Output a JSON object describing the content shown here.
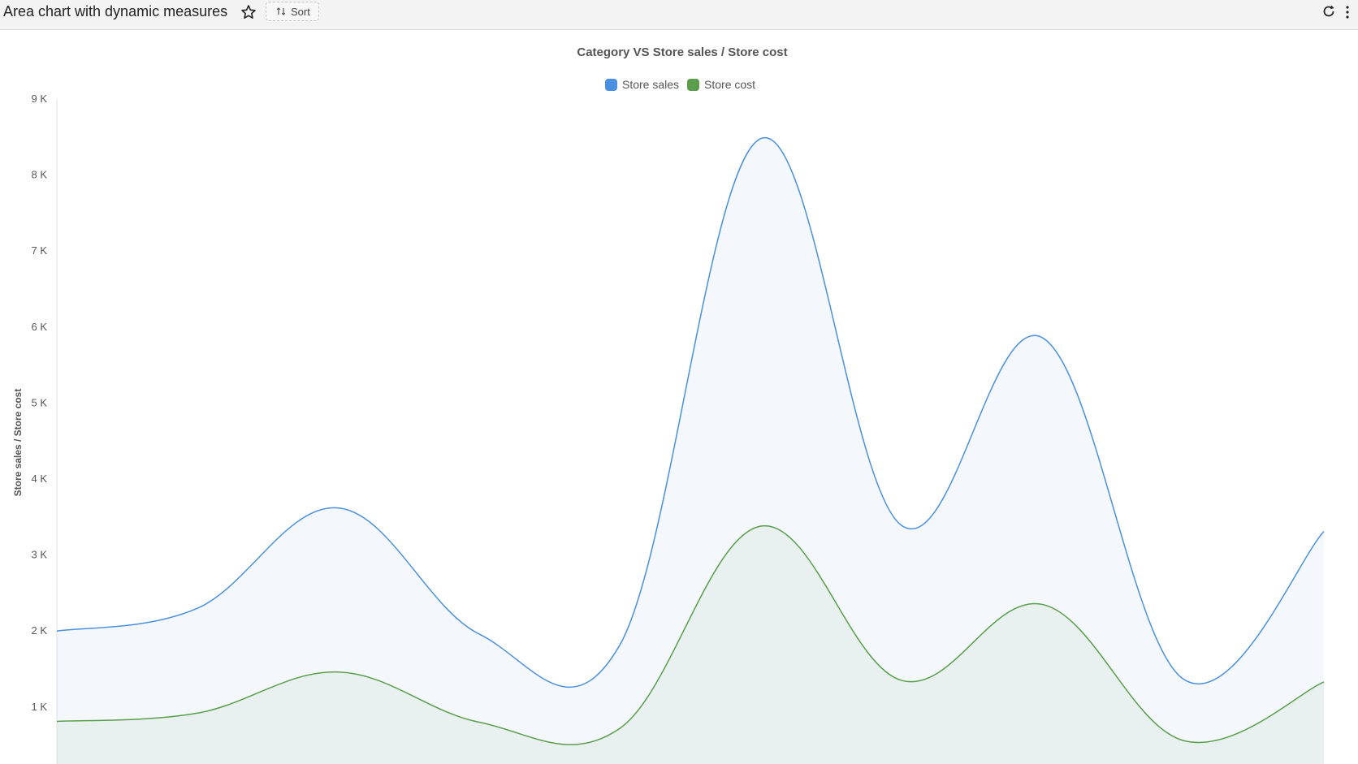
{
  "header": {
    "title": "Area chart with dynamic measures",
    "sort_label": "Sort",
    "icons": [
      "star-icon",
      "sort-icon",
      "refresh-icon",
      "more-vertical-icon"
    ]
  },
  "chart_data": {
    "type": "area",
    "title": "Category VS Store sales / Store cost",
    "xlabel": "",
    "ylabel": "Store sales / Store cost",
    "ylim": [
      250,
      9000
    ],
    "yticks": [
      1000,
      2000,
      3000,
      4000,
      5000,
      6000,
      7000,
      8000,
      9000
    ],
    "ytick_labels": [
      "1 K",
      "2 K",
      "3 K",
      "4 K",
      "5 K",
      "6 K",
      "7 K",
      "8 K",
      "9 K"
    ],
    "grid": false,
    "legend_position": "top-center",
    "series": [
      {
        "name": "Store sales",
        "color": "#4a90e2",
        "values": [
          2000,
          2300,
          3620,
          1960,
          1820,
          8480,
          3390,
          5860,
          1370,
          3310
        ]
      },
      {
        "name": "Store cost",
        "color": "#5a9e4b",
        "values": [
          810,
          920,
          1460,
          800,
          720,
          3380,
          1350,
          2350,
          560,
          1330
        ]
      }
    ]
  }
}
